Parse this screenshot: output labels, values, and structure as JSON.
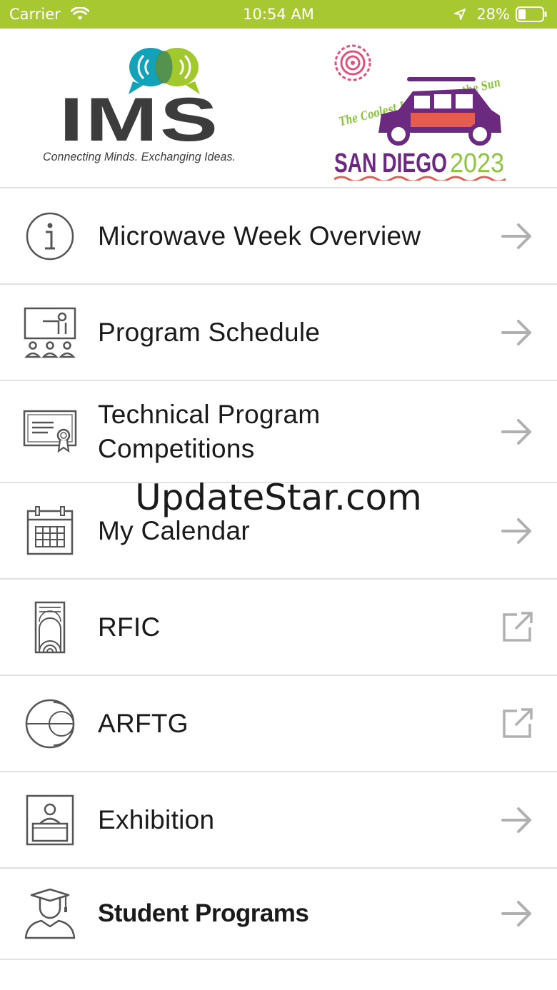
{
  "status_bar": {
    "carrier": "Carrier",
    "time": "10:54 AM",
    "battery": "28%",
    "color": "#a8c832"
  },
  "header": {
    "ims_logo": {
      "wordmark": "IMS",
      "tagline": "Connecting Minds. Exchanging Ideas."
    },
    "event_logo": {
      "slogan": "The Coolest Ideas Under the Sun",
      "city": "SAN DIEGO",
      "year": "2023"
    }
  },
  "menu": {
    "items": [
      {
        "label": "Microwave Week Overview",
        "icon": "info-icon",
        "action": "arrow-right-icon"
      },
      {
        "label": "Program Schedule",
        "icon": "presentation-icon",
        "action": "arrow-right-icon"
      },
      {
        "label": "Technical Program\nCompetitions",
        "icon": "certificate-icon",
        "action": "arrow-right-icon"
      },
      {
        "label": "My Calendar",
        "icon": "calendar-icon",
        "action": "arrow-right-icon"
      },
      {
        "label": "RFIC",
        "icon": "rfic-icon",
        "action": "external-link-icon"
      },
      {
        "label": "ARFTG",
        "icon": "smith-chart-icon",
        "action": "external-link-icon"
      },
      {
        "label": "Exhibition",
        "icon": "exhibitor-booth-icon",
        "action": "arrow-right-icon"
      },
      {
        "label": "Student Programs",
        "icon": "graduate-icon",
        "action": "arrow-right-icon"
      }
    ]
  },
  "watermark": "UpdateStar.com",
  "colors": {
    "icon_gray": "#555555",
    "arrow_gray": "#b0b0b0",
    "divider": "#e2e2e2"
  }
}
